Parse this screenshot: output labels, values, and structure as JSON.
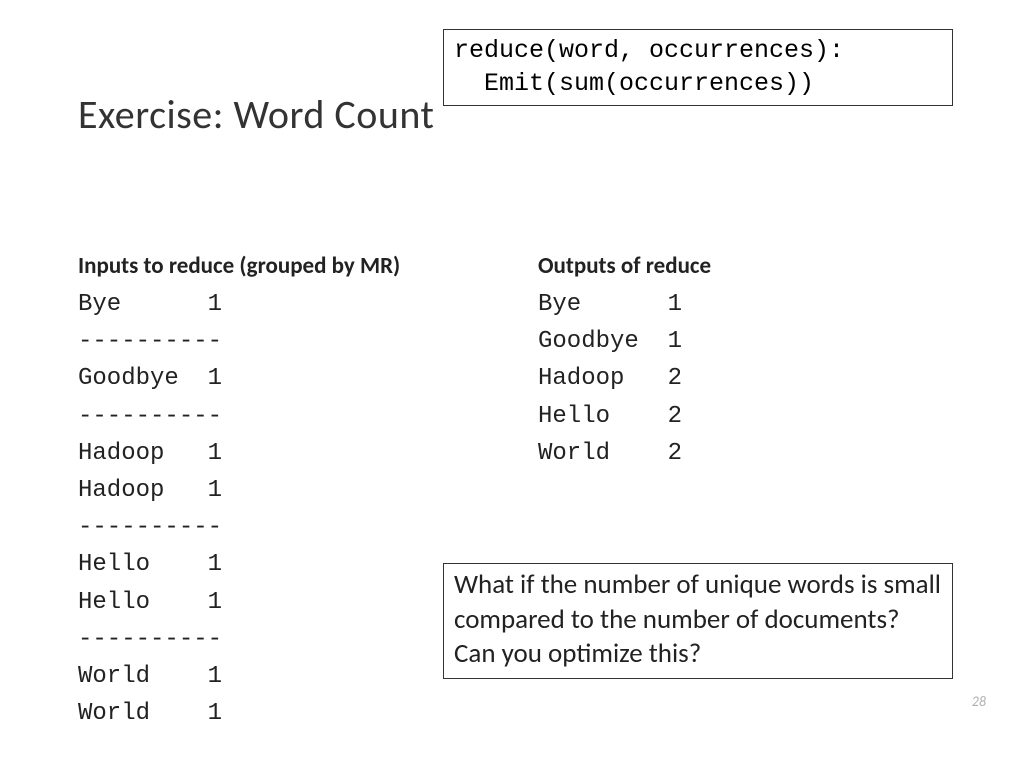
{
  "title": "Exercise: Word Count",
  "code_box": {
    "line1": "reduce(word, occurrences):",
    "line2": "  Emit(sum(occurrences))"
  },
  "inputs": {
    "header": "Inputs to reduce (grouped by MR)",
    "groups": [
      [
        {
          "word": "Bye",
          "count": "1"
        }
      ],
      [
        {
          "word": "Goodbye",
          "count": "1"
        }
      ],
      [
        {
          "word": "Hadoop",
          "count": "1"
        },
        {
          "word": "Hadoop",
          "count": "1"
        }
      ],
      [
        {
          "word": "Hello",
          "count": "1"
        },
        {
          "word": "Hello",
          "count": "1"
        }
      ],
      [
        {
          "word": "World",
          "count": "1"
        },
        {
          "word": "World",
          "count": "1"
        }
      ]
    ],
    "separator": "----------"
  },
  "outputs": {
    "header": "Outputs of reduce",
    "rows": [
      {
        "word": "Bye",
        "count": "1"
      },
      {
        "word": "Goodbye",
        "count": "1"
      },
      {
        "word": "Hadoop",
        "count": "2"
      },
      {
        "word": "Hello",
        "count": "2"
      },
      {
        "word": "World",
        "count": "2"
      }
    ]
  },
  "question": "What if the number of unique words is small compared to the number of documents? Can you optimize this?",
  "page_number": "28"
}
